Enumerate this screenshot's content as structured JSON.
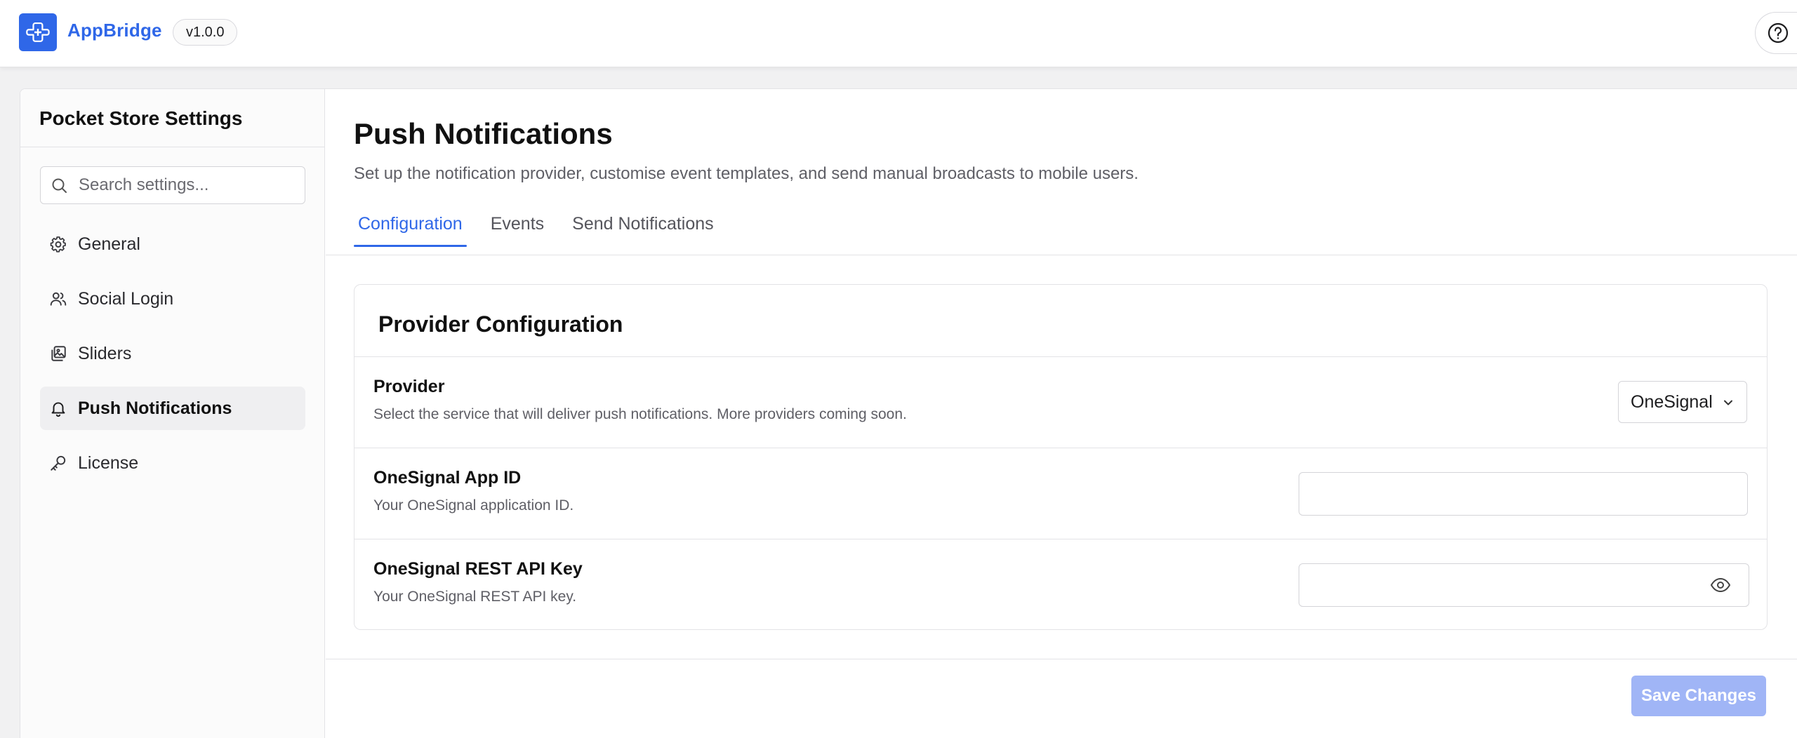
{
  "header": {
    "brand_name": "AppBridge",
    "version": "v1.0.0",
    "accent_color": "#2f67e8"
  },
  "sidebar": {
    "title": "Pocket Store Settings",
    "search_placeholder": "Search settings...",
    "items": [
      {
        "label": "General",
        "icon": "gear-icon",
        "active": false
      },
      {
        "label": "Social Login",
        "icon": "users-icon",
        "active": false
      },
      {
        "label": "Sliders",
        "icon": "images-icon",
        "active": false
      },
      {
        "label": "Push Notifications",
        "icon": "bell-icon",
        "active": true
      },
      {
        "label": "License",
        "icon": "key-icon",
        "active": false
      }
    ]
  },
  "main": {
    "title": "Push Notifications",
    "subtitle": "Set up the notification provider, customise event templates, and send manual broadcasts to mobile users.",
    "tabs": [
      {
        "label": "Configuration",
        "active": true
      },
      {
        "label": "Events",
        "active": false
      },
      {
        "label": "Send Notifications",
        "active": false
      }
    ],
    "panel": {
      "title": "Provider Configuration",
      "provider": {
        "label": "Provider",
        "description": "Select the service that will deliver push notifications. More providers coming soon.",
        "selected": "OneSignal"
      },
      "app_id": {
        "label": "OneSignal App ID",
        "description": "Your OneSignal application ID.",
        "value": ""
      },
      "api_key": {
        "label": "OneSignal REST API Key",
        "description": "Your OneSignal REST API key.",
        "value": ""
      }
    },
    "save_label": "Save Changes",
    "save_color": "#a0b5f6"
  }
}
